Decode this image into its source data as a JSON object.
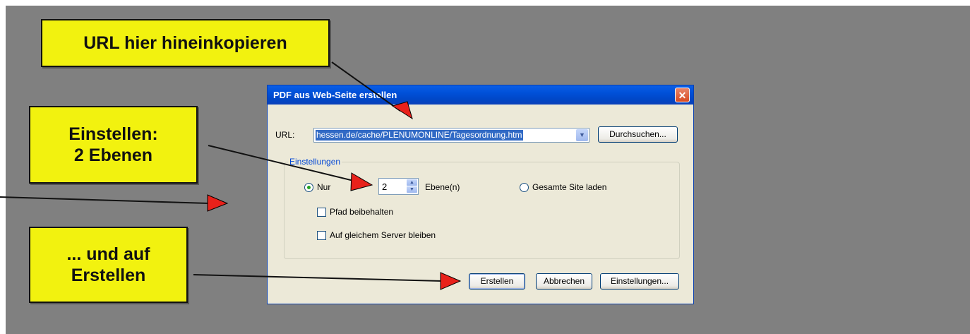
{
  "callouts": {
    "url": "URL hier hineinkopieren",
    "ebenen_line1": "Einstellen:",
    "ebenen_line2": "2 Ebenen",
    "erstellen_line1": "... und auf",
    "erstellen_line2": "Erstellen"
  },
  "dialog": {
    "title": "PDF aus Web-Seite erstellen",
    "close_symbol": "✕",
    "url_label": "URL:",
    "url_value": "hessen.de/cache/PLENUMONLINE/Tagesordnung.htm",
    "url_dropdown_symbol": "▼",
    "browse_label": "Durchsuchen...",
    "group_title": "Einstellungen",
    "radio_nur_label": "Nur",
    "radio_nur_checked": true,
    "levels_value": "2",
    "levels_unit": "Ebene(n)",
    "radio_site_label": "Gesamte Site laden",
    "radio_site_checked": false,
    "checkbox_pfad_label": "Pfad beibehalten",
    "checkbox_pfad_checked": false,
    "checkbox_server_label": "Auf gleichem Server bleiben",
    "checkbox_server_checked": false,
    "create_label": "Erstellen",
    "cancel_label": "Abbrechen",
    "settings_label": "Einstellungen..."
  },
  "colors": {
    "background": "#808080",
    "callout_fill": "#f2f20f",
    "arrow_fill": "#e8211a",
    "titlebar": "#0050d8",
    "dialog_face": "#ece9d8"
  },
  "icons": {
    "close": "close-icon",
    "dropdown": "chevron-down-icon",
    "spin_up": "spin-up-icon",
    "spin_down": "spin-down-icon",
    "arrow": "red-arrow-icon"
  }
}
